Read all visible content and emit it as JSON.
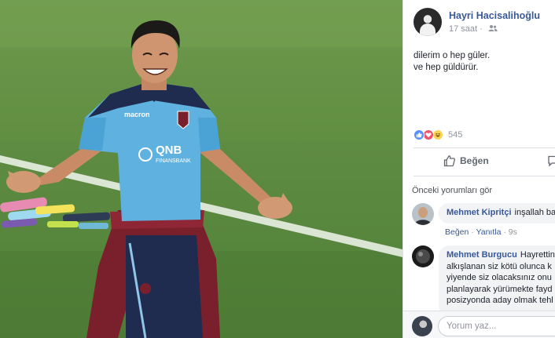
{
  "post": {
    "author": "Hayri Hacisalihoğlu",
    "time": "17 saat",
    "text_lines": [
      "dilerim o hep güler.",
      "ve hep güldürür."
    ],
    "reaction_count": "545",
    "like_label": "Beğen"
  },
  "comments": {
    "previous_label": "Önceki yorumları gör",
    "items": [
      {
        "name": "Mehmet Kipritçi",
        "text": "inşallah ba",
        "like": "Beğen",
        "reply": "Yanıtla",
        "time": "9s"
      },
      {
        "name": "Mehmet Burgucu",
        "lines": [
          "Hayrettin",
          "alkışlanan siz kötü olunca k",
          "yiyende siz olacaksınız onu",
          "planlayarak yürümekte fayd",
          "posizyonda aday olmak tehl"
        ]
      }
    ]
  },
  "composer": {
    "placeholder": "Yorum yaz..."
  },
  "photo": {
    "kit_brand": "macron",
    "sponsor": "QNB",
    "sponsor_sub": "FINANSBANK"
  },
  "colors": {
    "link": "#385898",
    "muted": "#90949c",
    "like_reaction": "#5890ff",
    "love_reaction": "#f25268",
    "haha_reaction": "#fdd451"
  },
  "icons": [
    "friends-icon",
    "like-reaction-icon",
    "love-reaction-icon",
    "haha-reaction-icon",
    "thumbs-up-icon",
    "comment-icon"
  ]
}
